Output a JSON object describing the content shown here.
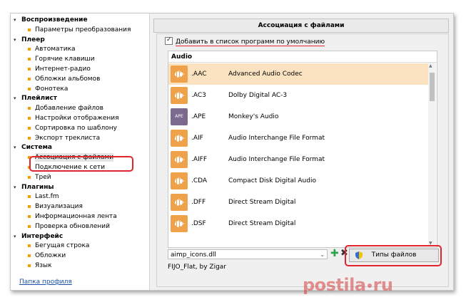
{
  "tree": {
    "categories": [
      {
        "label": "Воспроизведение",
        "items": [
          "Параметры преобразования"
        ]
      },
      {
        "label": "Плеер",
        "items": [
          "Автоматика",
          "Горячие клавиши",
          "Интернет-радио",
          "Обложки альбомов",
          "Фонотека"
        ]
      },
      {
        "label": "Плейлист",
        "items": [
          "Добавление файлов",
          "Настройки отображения",
          "Сортировка по шаблону",
          "Экспорт треклиста"
        ]
      },
      {
        "label": "Система",
        "items": [
          "Ассоциация с файлами",
          "Подключение к сети",
          "Трей"
        ]
      },
      {
        "label": "Плагины",
        "items": [
          "Last.fm",
          "Визуализация",
          "Информационная лента",
          "Проверка обновлений"
        ]
      },
      {
        "label": "Интерфейс",
        "items": [
          "Бегущая строка",
          "Обложки",
          "Язык"
        ]
      }
    ],
    "selected_item": "Ассоциация с файлами",
    "profile_link": "Папка профиля"
  },
  "panel": {
    "title": "Ассоциация с файлами",
    "checkbox_label": "Добавить в список программ по умолчанию",
    "checkbox_checked": true,
    "list_header": "Audio",
    "rows": [
      {
        "ext": ".AAC",
        "desc": "Advanced Audio Codec",
        "icon": "audio-wave-icon",
        "selected": true
      },
      {
        "ext": ".AC3",
        "desc": "Dolby Digital AC-3",
        "icon": "audio-wave-icon"
      },
      {
        "ext": ".APE",
        "desc": "Monkey's Audio",
        "icon": "ape-icon",
        "icon_text": "APE"
      },
      {
        "ext": ".AIF",
        "desc": "Audio Interchange File Format",
        "icon": "audio-wave-icon"
      },
      {
        "ext": ".AIFF",
        "desc": "Audio Interchange File Format",
        "icon": "audio-wave-icon"
      },
      {
        "ext": ".CDA",
        "desc": "Compact Disk Digital Audio",
        "icon": "audio-wave-icon"
      },
      {
        "ext": ".DFF",
        "desc": "Direct Stream Digital",
        "icon": "audio-wave-icon"
      },
      {
        "ext": ".DSF",
        "desc": "Direct Stream Digital",
        "icon": "audio-wave-icon"
      }
    ],
    "icon_set_value": "aimp_icons.dll",
    "file_types_button": "Типы файлов",
    "skin_credit": "FIJO_Flat, by Zigar"
  },
  "colors": {
    "accent": "#f5a000",
    "highlight": "#e2252c",
    "icon_orange": "#f0a24a",
    "icon_purple": "#7c6a8e",
    "selected_row": "#fbe3c2"
  },
  "watermark": {
    "left": "postila",
    "right": "ru"
  }
}
